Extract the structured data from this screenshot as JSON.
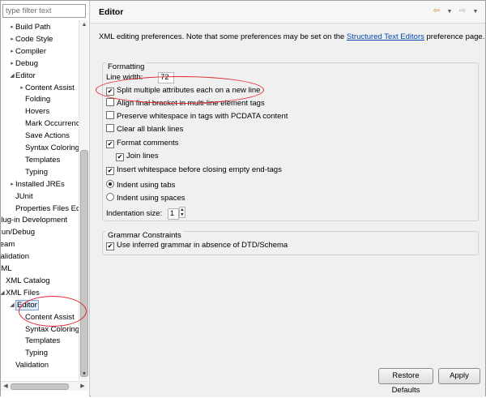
{
  "filter": {
    "placeholder": "type filter text"
  },
  "tree": {
    "items": [
      {
        "label": "Build Path",
        "toggle": "▸",
        "indent": 0
      },
      {
        "label": "Code Style",
        "toggle": "▸",
        "indent": 0
      },
      {
        "label": "Compiler",
        "toggle": "▸",
        "indent": 0
      },
      {
        "label": "Debug",
        "toggle": "▸",
        "indent": 0
      },
      {
        "label": "Editor",
        "toggle": "◢",
        "indent": 0
      },
      {
        "label": "Content Assist",
        "toggle": "▸",
        "indent": 1
      },
      {
        "label": "Folding",
        "toggle": "",
        "indent": 1
      },
      {
        "label": "Hovers",
        "toggle": "",
        "indent": 1
      },
      {
        "label": "Mark Occurrences",
        "toggle": "",
        "indent": 1
      },
      {
        "label": "Save Actions",
        "toggle": "",
        "indent": 1
      },
      {
        "label": "Syntax Coloring",
        "toggle": "",
        "indent": 1
      },
      {
        "label": "Templates",
        "toggle": "",
        "indent": 1
      },
      {
        "label": "Typing",
        "toggle": "",
        "indent": 1
      },
      {
        "label": "Installed JREs",
        "toggle": "▸",
        "indent": 0
      },
      {
        "label": "JUnit",
        "toggle": "",
        "indent": 0
      },
      {
        "label": "Properties Files Editor",
        "toggle": "",
        "indent": 0
      },
      {
        "label": "Plug-in Development",
        "toggle": "▸",
        "indent": -2
      },
      {
        "label": "Run/Debug",
        "toggle": "▸",
        "indent": -2
      },
      {
        "label": "Team",
        "toggle": "▸",
        "indent": -2
      },
      {
        "label": "Validation",
        "toggle": "",
        "indent": -2
      },
      {
        "label": "XML",
        "toggle": "◢",
        "indent": -2
      },
      {
        "label": "XML Catalog",
        "toggle": "",
        "indent": -1
      },
      {
        "label": "XML Files",
        "toggle": "◢",
        "indent": -1
      },
      {
        "label": "Editor",
        "toggle": "◢",
        "indent": 0,
        "selected": true
      },
      {
        "label": "Content Assist",
        "toggle": "",
        "indent": 1
      },
      {
        "label": "Syntax Coloring",
        "toggle": "",
        "indent": 1
      },
      {
        "label": "Templates",
        "toggle": "",
        "indent": 1
      },
      {
        "label": "Typing",
        "toggle": "",
        "indent": 1
      },
      {
        "label": "Validation",
        "toggle": "",
        "indent": 0
      }
    ]
  },
  "page": {
    "title": "Editor",
    "description_prefix": "XML editing preferences.  Note that some preferences may be set on the ",
    "description_link": "Structured Text Editors",
    "description_suffix": " preference page."
  },
  "formatting": {
    "title": "Formatting",
    "line_width_label": "Line width:",
    "line_width_value": "72",
    "options": [
      {
        "label": "Split multiple attributes each on a new line",
        "checked": true,
        "indent": 0
      },
      {
        "label": "Align final bracket in multi-line element tags",
        "checked": false,
        "indent": 0
      },
      {
        "label": "Preserve whitespace in tags with PCDATA content",
        "checked": false,
        "indent": 0
      },
      {
        "label": "Clear all blank lines",
        "checked": false,
        "indent": 0
      },
      {
        "label": "Format comments",
        "checked": true,
        "indent": 0
      },
      {
        "label": "Join lines",
        "checked": true,
        "indent": 1
      },
      {
        "label": "Insert whitespace before closing empty end-tags",
        "checked": true,
        "indent": 0
      }
    ],
    "indent_tabs_label": "Indent using tabs",
    "indent_spaces_label": "Indent using spaces",
    "indent_using_tabs": true,
    "indentation_size_label": "Indentation size:",
    "indentation_size_value": "1"
  },
  "grammar": {
    "title": "Grammar Constraints",
    "option_label": "Use inferred grammar in absence of DTD/Schema",
    "checked": true
  },
  "buttons": {
    "restore_defaults": "Restore Defaults",
    "apply": "Apply"
  },
  "icons": {
    "back": "back-arrow-icon",
    "forward": "forward-arrow-icon",
    "menu": "chevron-down-icon",
    "check": "✔"
  },
  "colors": {
    "annotation": "#e0242b",
    "link": "#0645ad",
    "selection": "#dcebfc"
  }
}
